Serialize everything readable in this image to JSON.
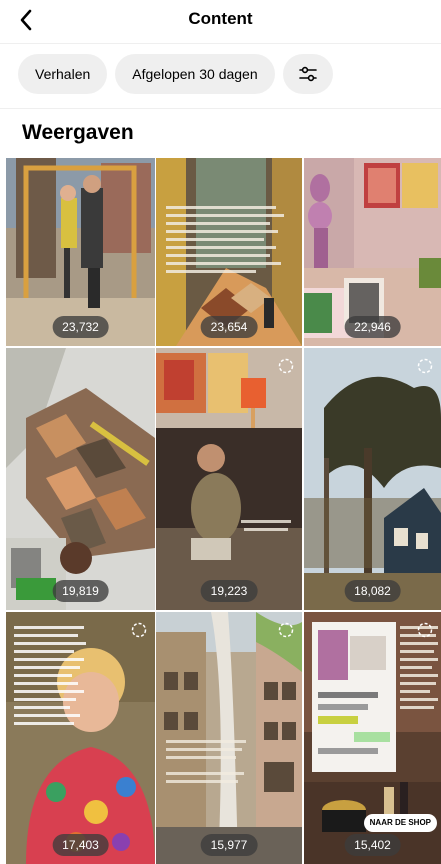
{
  "header": {
    "title": "Content",
    "back_icon": "chevron-left-icon"
  },
  "filters": [
    {
      "label": "Verhalen"
    },
    {
      "label": "Afgelopen 30 dagen"
    },
    {
      "label": "",
      "icon": "sliders-icon"
    }
  ],
  "section": {
    "title": "Weergaven"
  },
  "tiles": [
    {
      "views": "23,732"
    },
    {
      "views": "23,654"
    },
    {
      "views": "22,946"
    },
    {
      "views": "19,819"
    },
    {
      "views": "19,223"
    },
    {
      "views": "18,082"
    },
    {
      "views": "17,403"
    },
    {
      "views": "15,977"
    },
    {
      "views": "15,402",
      "shop_label": "NAAR DE SHOP"
    }
  ]
}
